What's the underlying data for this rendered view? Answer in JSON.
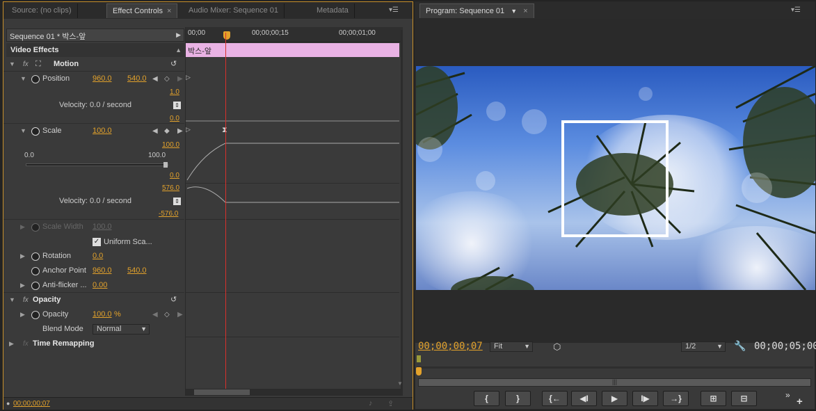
{
  "left_tabs": [
    "Source: (no clips)",
    "Effect Controls",
    "Audio Mixer: Sequence 01",
    "Metadata"
  ],
  "right_tabs": [
    "Program: Sequence 01"
  ],
  "clip_header": "Sequence 01 * 박스-앞",
  "ruler": {
    "t0": "00;00",
    "t1": "00;00;00;15",
    "t2": "00;00;01;00"
  },
  "clip_label": "박스-앞",
  "video_effects": "Video Effects",
  "motion": {
    "label": "Motion",
    "position": {
      "label": "Position",
      "x": "960.0",
      "y": "540.0",
      "graph_max": "1.0",
      "graph_min": "0.0",
      "velocity": "Velocity: 0.0 / second"
    },
    "scale": {
      "label": "Scale",
      "value": "100.0",
      "slider_min": "0.0",
      "slider_max": "100.0",
      "graph_max": "100.0",
      "graph_min": "0.0",
      "vel_max": "576.0",
      "vel_min": "-576.0",
      "velocity": "Velocity: 0.0 / second"
    },
    "scale_width": {
      "label": "Scale Width",
      "value": "100.0"
    },
    "uniform": "Uniform Sca...",
    "rotation": {
      "label": "Rotation",
      "value": "0.0"
    },
    "anchor": {
      "label": "Anchor Point",
      "x": "960.0",
      "y": "540.0"
    },
    "antiflicker": {
      "label": "Anti-flicker ...",
      "value": "0.00"
    }
  },
  "opacity": {
    "label": "Opacity",
    "sub": "Opacity",
    "value": "100.0",
    "unit": "%",
    "blend_label": "Blend Mode",
    "blend_value": "Normal"
  },
  "time_remap": "Time Remapping",
  "ec_timecode": "00;00;00;07",
  "program": {
    "timecode": "00;00;00;07",
    "fit": "Fit",
    "res": "1/2",
    "duration": "00;00;05;00"
  },
  "buttons": {
    "mark_in": "{",
    "mark_out": "}",
    "go_in": "{←",
    "step_back": "◀I",
    "play": "▶",
    "step_fwd": "I▶",
    "go_out": "→}",
    "lift": "⊞",
    "extract": "⊟",
    "more": "»",
    "add": "+"
  },
  "colors": {
    "accent": "#e3a22b",
    "clip": "#e9b2e4",
    "playhead": "#d9302b"
  }
}
